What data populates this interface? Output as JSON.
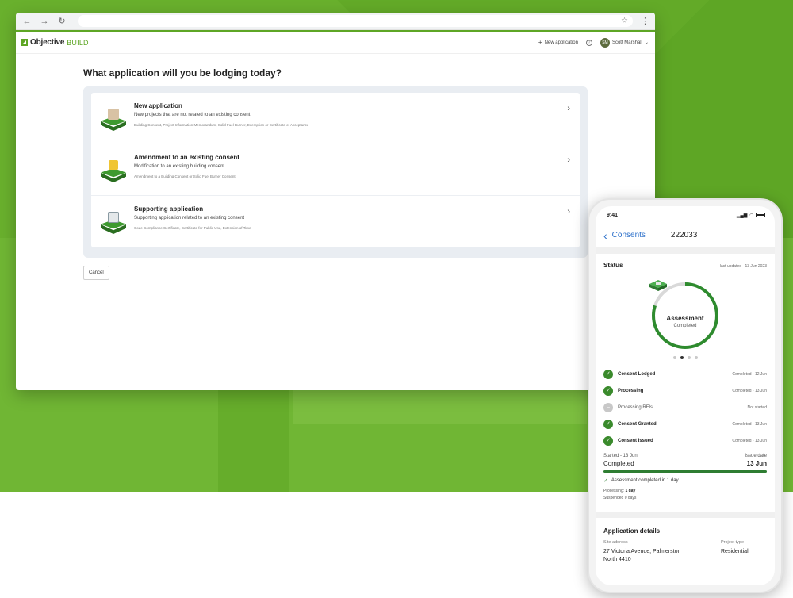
{
  "colors": {
    "brand_green": "#5ea625",
    "status_green": "#3a8a2c",
    "link_blue": "#2b6fc9"
  },
  "browser": {
    "nav_icons": [
      "back-icon",
      "forward-icon",
      "reload-icon"
    ],
    "star_icon": "star-icon",
    "menu_icon": "menu-dots-icon"
  },
  "app": {
    "logo_text": "Objective",
    "logo_suffix": "BUILD",
    "header": {
      "new_application": "New application",
      "user_initials": "SM",
      "user_name": "Scott Marshall"
    },
    "page_title": "What application will you be lodging today?",
    "options": [
      {
        "title": "New application",
        "description": "New projects that are not related to an existing consent",
        "sub": "Building Consent, Project Information Memorandum, Solid Fuel Burner, Exemption or Certificate of Acceptance"
      },
      {
        "title": "Amendment to an existing consent",
        "description": "Modification to an existing building consent",
        "sub": "Amendment to a Building Consent or Solid Fuel Burner Consent"
      },
      {
        "title": "Supporting application",
        "description": "Supporting application related to an existing consent",
        "sub": "Code Compliance Certificate, Certificate for Public Use, Extension of Time"
      }
    ],
    "cancel_label": "Cancel"
  },
  "phone": {
    "time": "9:41",
    "nav": {
      "back_label": "Consents",
      "consent_number": "222033"
    },
    "status": {
      "label": "Status",
      "last_updated": "last updated - 13 Jun 2023",
      "ring_title": "Assessment",
      "ring_sub": "Completed",
      "ring_progress": 0.8,
      "steps": [
        {
          "name": "Consent Lodged",
          "status": "Completed - 12 Jun",
          "done": true
        },
        {
          "name": "Processing",
          "status": "Completed - 13 Jun",
          "done": true
        },
        {
          "name": "Processing RFIs",
          "status": "Not started",
          "done": false
        },
        {
          "name": "Consent Granted",
          "status": "Completed - 13 Jun",
          "done": true
        },
        {
          "name": "Consent Issued",
          "status": "Completed - 13 Jun",
          "done": true
        }
      ],
      "started_label": "Started - 13 Jun",
      "started_value": "Completed",
      "issue_label": "Issue date",
      "issue_value": "13 Jun",
      "progress": 1.0,
      "assessment_note": "Assessment completed in 1 day",
      "processing_label": "Processing:",
      "processing_value": "1 day",
      "suspended": "Suspended 0 days"
    },
    "details": {
      "title": "Application details",
      "site_address_label": "Site address",
      "site_address_line1": "27 Victoria Avenue, Palmerston",
      "site_address_line2": "North 4410",
      "project_type_label": "Project type",
      "project_type_value": "Residential"
    }
  }
}
